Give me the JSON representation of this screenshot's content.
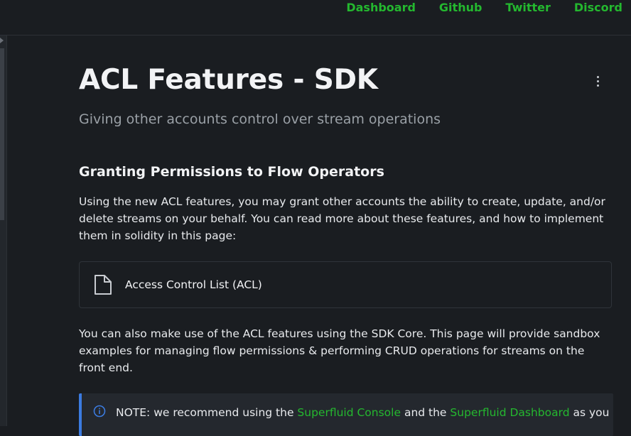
{
  "nav": {
    "links": [
      "Dashboard",
      "Github",
      "Twitter",
      "Discord"
    ]
  },
  "page": {
    "title": "ACL Features - SDK",
    "subtitle": "Giving other accounts control over stream operations",
    "section_heading": "Granting Permissions to Flow Operators",
    "para1": "Using the new ACL features, you may grant other accounts the ability to create, update, and/or delete streams on your behalf. You can read more about these features, and how to implement them in solidity in this page:",
    "card_label": "Access Control List (ACL)",
    "para2": "You can also make use of the ACL features using the SDK Core. This page will provide sandbox examples for managing flow permissions & performing CRUD operations for streams on the front end.",
    "note_prefix": "NOTE: we recommend using the ",
    "note_link1": "Superfluid Console",
    "note_mid": " and the ",
    "note_link2": "Superfluid Dashboard",
    "note_suffix": " as you"
  },
  "icons": {
    "kebab": "more-vert-icon",
    "doc": "document-icon",
    "info": "info-icon"
  },
  "colors": {
    "accent_green": "#24b82f",
    "note_border": "#3b7be0",
    "background": "#1a1d21"
  }
}
